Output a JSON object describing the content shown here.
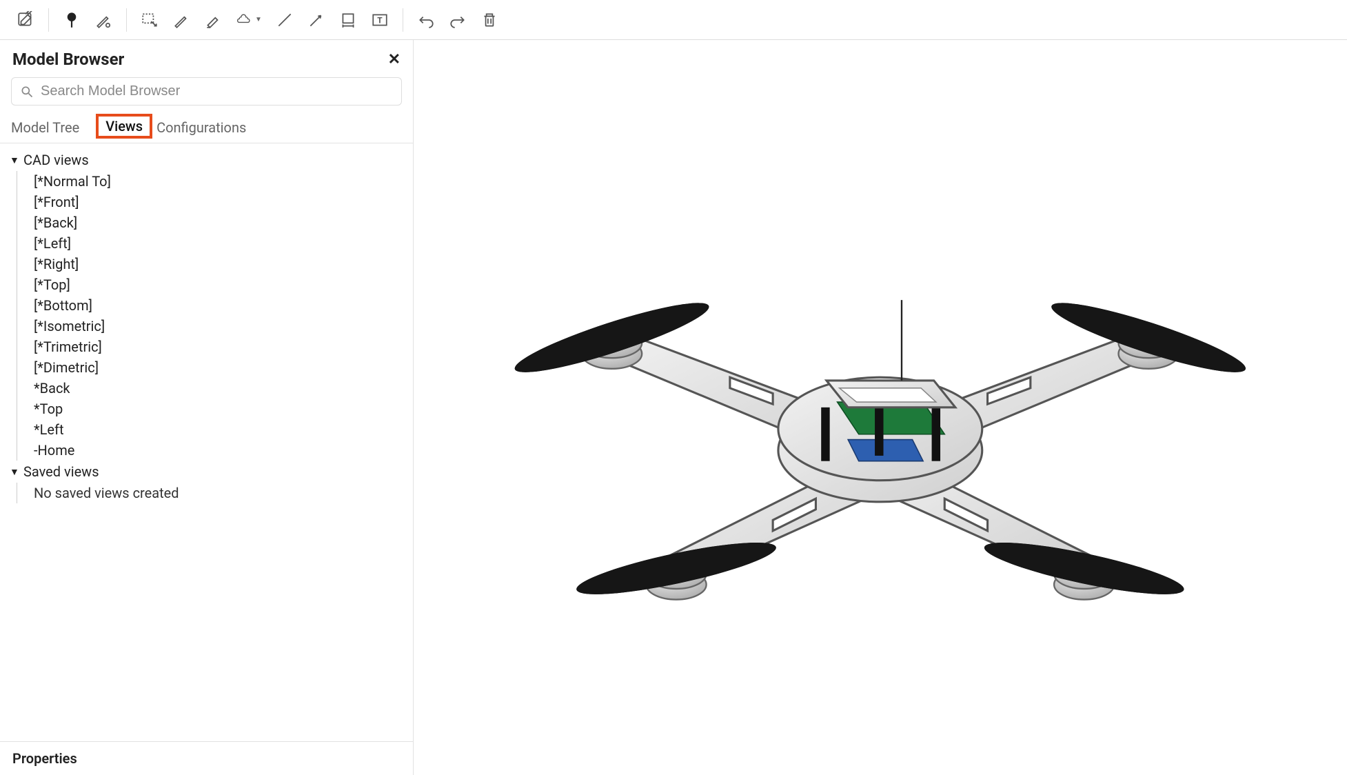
{
  "toolbar": {
    "buttons": [
      "edit-sketch",
      "pin",
      "pencil-3d",
      "selection-box",
      "pencil",
      "highlighter",
      "cloud",
      "line",
      "arrow",
      "dimension",
      "text-box",
      "undo",
      "redo",
      "trash"
    ]
  },
  "panel": {
    "title": "Model Browser",
    "close_label": "✕",
    "search_placeholder": "Search Model Browser",
    "tabs": {
      "model_tree": "Model Tree",
      "views": "Views",
      "configurations": "Configurations",
      "active": "views"
    },
    "groups": [
      {
        "label": "CAD views",
        "expanded": true,
        "items": [
          "[*Normal To]",
          "[*Front]",
          "[*Back]",
          "[*Left]",
          "[*Right]",
          "[*Top]",
          "[*Bottom]",
          "[*Isometric]",
          "[*Trimetric]",
          "[*Dimetric]",
          "*Back",
          "*Top",
          "*Left",
          "-Home"
        ]
      },
      {
        "label": "Saved views",
        "expanded": true,
        "items": [
          "No saved views created"
        ]
      }
    ],
    "properties_label": "Properties"
  },
  "viewport": {
    "model_name": "quadcopter-drone"
  }
}
